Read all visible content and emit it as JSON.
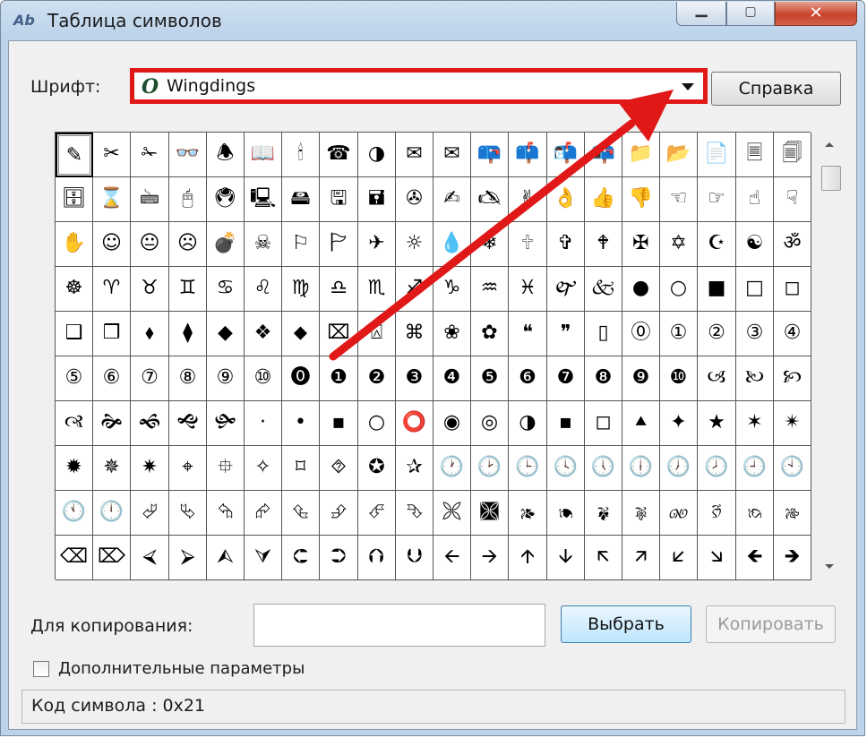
{
  "window": {
    "title": "Таблица символов",
    "app_icon": "Ab",
    "buttons": {
      "minimize": "▁",
      "maximize": "▢",
      "close": "✕"
    }
  },
  "font_row": {
    "label": "Шрифт:",
    "font_icon": "O",
    "selected_font": "Wingdings",
    "help_button": "Справка"
  },
  "grid": {
    "selected_index": 0,
    "rows": [
      [
        "✎",
        "✂",
        "✁",
        "👓",
        "🕭",
        "📖",
        "🕯",
        "☎",
        "◑",
        "✉",
        "✉",
        "📪",
        "📫",
        "📬",
        "📭",
        "📁",
        "📂",
        "📄",
        "🗏",
        "🗐"
      ],
      [
        "🗄",
        "⌛",
        "🖮",
        "🖰",
        "🖲",
        "🖳",
        "🖴",
        "🖫",
        "🖬",
        "✇",
        "✍",
        "🖎",
        "✌",
        "👌",
        "👍",
        "👎",
        "☜",
        "☞",
        "☝",
        "☟"
      ],
      [
        "✋",
        "☺",
        "😐",
        "☹",
        "💣",
        "☠",
        "⚐",
        "🏱",
        "✈",
        "☼",
        "💧",
        "❄",
        "🕆",
        "✞",
        "🕈",
        "✠",
        "✡",
        "☪",
        "☯",
        "ॐ"
      ],
      [
        "☸",
        "♈",
        "♉",
        "♊",
        "♋",
        "♌",
        "♍",
        "♎",
        "♏",
        "♐",
        "♑",
        "♒",
        "♓",
        "🙰",
        "🙵",
        "●",
        "○",
        "■",
        "□",
        "◻"
      ],
      [
        "❑",
        "❒",
        "⬧",
        "⧫",
        "◆",
        "❖",
        "⬥",
        "⌧",
        "⍓",
        "⌘",
        "❀",
        "✿",
        "❝",
        "❞",
        "▯",
        "⓪",
        "①",
        "②",
        "③",
        "④"
      ],
      [
        "⑤",
        "⑥",
        "⑦",
        "⑧",
        "⑨",
        "⑩",
        "⓿",
        "❶",
        "❷",
        "❸",
        "❹",
        "❺",
        "❻",
        "❼",
        "❽",
        "❾",
        "❿",
        "🙢",
        "🙠",
        "🙡"
      ],
      [
        "🙣",
        "🙞",
        "🙜",
        "🙝",
        "🙟",
        "·",
        "•",
        "▪",
        "○",
        "⭕",
        "◉",
        "◎",
        "◑",
        "▪",
        "◻",
        "⯅",
        "✦",
        "★",
        "✶",
        "✴"
      ],
      [
        "✹",
        "✵",
        "✷",
        "⌖",
        "⯐",
        "✧",
        "⌑",
        "⯑",
        "✪",
        "✰",
        "🕐",
        "🕑",
        "🕒",
        "🕓",
        "🕔",
        "🕕",
        "🕖",
        "🕗",
        "🕘",
        "🕙"
      ],
      [
        "🕚",
        "🕛",
        "⮰",
        "⮱",
        "⮲",
        "⮳",
        "⮴",
        "⮵",
        "⮶",
        "⮷",
        "🙪",
        "🙫",
        "🙕",
        "🙔",
        "🙗",
        "🙖",
        "🙐",
        "🙑",
        "🙒",
        "🙓"
      ],
      [
        "⌫",
        "⌦",
        "⮘",
        "⮚",
        "⮙",
        "⮛",
        "⮈",
        "⮊",
        "⮉",
        "⮋",
        "🡨",
        "🡪",
        "🡩",
        "🡫",
        "🡬",
        "🡭",
        "🡯",
        "🡮",
        "🡸",
        "🡺"
      ]
    ]
  },
  "copy_row": {
    "label": "Для копирования:",
    "input_value": "",
    "select_button": "Выбрать",
    "copy_button": "Копировать"
  },
  "advanced": {
    "label": "Дополнительные параметры",
    "checked": false
  },
  "status": {
    "text": "Код символа : 0x21"
  },
  "annotation": {
    "color": "#e01818"
  }
}
